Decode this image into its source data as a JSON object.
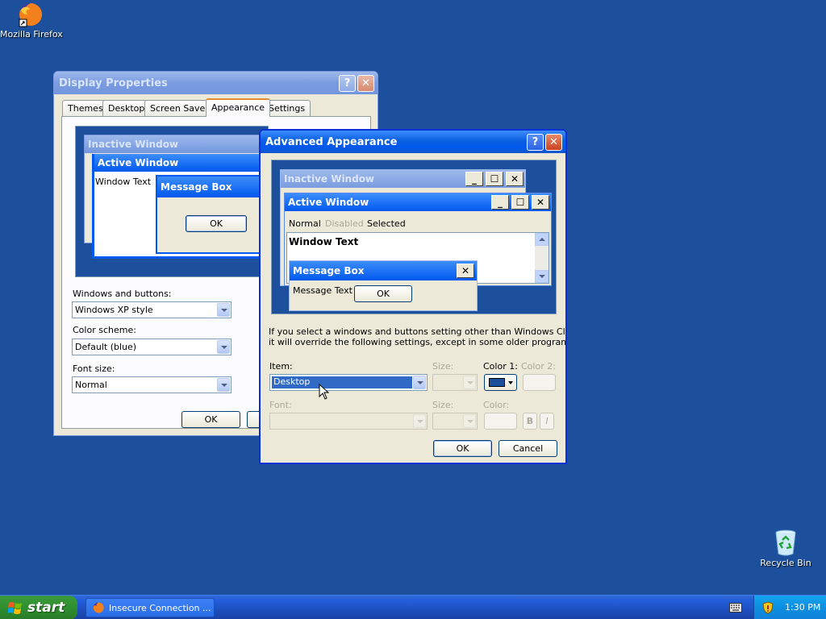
{
  "desktop": {
    "firefox_label": "Mozilla Firefox",
    "recycle_label": "Recycle Bin"
  },
  "display_props": {
    "title": "Display Properties",
    "help": "?",
    "close": "✕",
    "tabs": [
      "Themes",
      "Desktop",
      "Screen Saver",
      "Appearance",
      "Settings"
    ],
    "selected_tab": "Appearance",
    "preview": {
      "inactive_title": "Inactive Window",
      "active_title": "Active Window",
      "window_text": "Window Text",
      "message_title": "Message Box",
      "ok": "OK"
    },
    "windows_buttons_label": "Windows and buttons:",
    "windows_buttons_value": "Windows XP style",
    "color_scheme_label": "Color scheme:",
    "color_scheme_value": "Default (blue)",
    "font_size_label": "Font size:",
    "font_size_value": "Normal",
    "ok": "OK"
  },
  "advanced": {
    "title": "Advanced Appearance",
    "help": "?",
    "close": "✕",
    "preview": {
      "inactive_title": "Inactive Window",
      "active_title": "Active Window",
      "menu": [
        "Normal",
        "Disabled",
        "Selected"
      ],
      "window_text": "Window Text",
      "message_title": "Message Box",
      "message_text": "Message Text",
      "ok": "OK",
      "min": "_",
      "max": "☐",
      "close": "✕"
    },
    "info_line1": "If you select a windows and buttons setting other than Windows Classic,",
    "info_line2": "it will override the following settings, except in some older programs.",
    "item_label": "Item:",
    "item_value": "Desktop",
    "size_label": "Size:",
    "color1_label": "Color 1:",
    "color2_label": "Color 2:",
    "font_label": "Font:",
    "font_size_label": "Size:",
    "font_color_label": "Color:",
    "bold": "B",
    "italic": "I",
    "color1_swatch": "#1c4f9c",
    "ok": "OK",
    "cancel": "Cancel"
  },
  "taskbar": {
    "start": "start",
    "task_label": "Insecure Connection ...",
    "clock": "1:30 PM"
  },
  "colors": {
    "desktop": "#1c4f9c",
    "title_active": "#0058ee",
    "selection": "#316ac5"
  }
}
